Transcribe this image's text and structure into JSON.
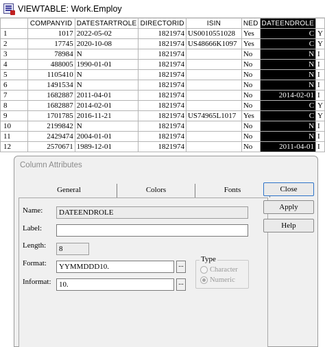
{
  "window": {
    "title": "VIEWTABLE: Work.Employ",
    "icon": "viewtable-icon"
  },
  "table": {
    "columns": [
      "",
      "COMPANYID",
      "DATESTARTROLE",
      "DIRECTORID",
      "ISIN",
      "NED",
      "DATEENDROLE",
      ""
    ],
    "selected_column": "DATEENDROLE",
    "rows": [
      [
        "1",
        "1017",
        "2022-05-02",
        "1821974",
        "US0010551028",
        "Yes",
        "C",
        "Y"
      ],
      [
        "2",
        "17745",
        "2020-10-08",
        "1821974",
        "US48666K1097",
        "Yes",
        "C",
        "Y"
      ],
      [
        "3",
        "78984",
        "N",
        "1821974",
        "",
        "No",
        "N",
        "I"
      ],
      [
        "4",
        "488005",
        "1990-01-01",
        "1821974",
        "",
        "No",
        "N",
        "I"
      ],
      [
        "5",
        "1105410",
        "N",
        "1821974",
        "",
        "No",
        "N",
        "I"
      ],
      [
        "6",
        "1491534",
        "N",
        "1821974",
        "",
        "No",
        "N",
        "I"
      ],
      [
        "7",
        "1682887",
        "2011-04-01",
        "1821974",
        "",
        "No",
        "2014-02-01",
        "I"
      ],
      [
        "8",
        "1682887",
        "2014-02-01",
        "1821974",
        "",
        "No",
        "C",
        "Y"
      ],
      [
        "9",
        "1701785",
        "2016-11-21",
        "1821974",
        "US74965L1017",
        "Yes",
        "C",
        "Y"
      ],
      [
        "10",
        "2199842",
        "N",
        "1821974",
        "",
        "No",
        "N",
        "I"
      ],
      [
        "11",
        "2429474",
        "2004-01-01",
        "1821974",
        "",
        "No",
        "N",
        "I"
      ],
      [
        "12",
        "2570671",
        "1989-12-01",
        "1821974",
        "",
        "No",
        "2011-04-01",
        "I"
      ]
    ]
  },
  "dialog": {
    "title": "Column Attributes",
    "tabs": [
      "General",
      "Colors",
      "Fonts"
    ],
    "active_tab": "General",
    "fields": {
      "name_label": "Name:",
      "name_value": "DATEENDROLE",
      "label_label": "Label:",
      "label_value": "",
      "length_label": "Length:",
      "length_value": "8",
      "format_label": "Format:",
      "format_value": "YYMMDDD10.",
      "informat_label": "Informat:",
      "informat_value": "10.",
      "browse_label": "..."
    },
    "type_group": {
      "title": "Type",
      "options": [
        "Character",
        "Numeric"
      ],
      "selected": "Numeric"
    },
    "buttons": {
      "close": "Close",
      "apply": "Apply",
      "help": "Help"
    }
  }
}
